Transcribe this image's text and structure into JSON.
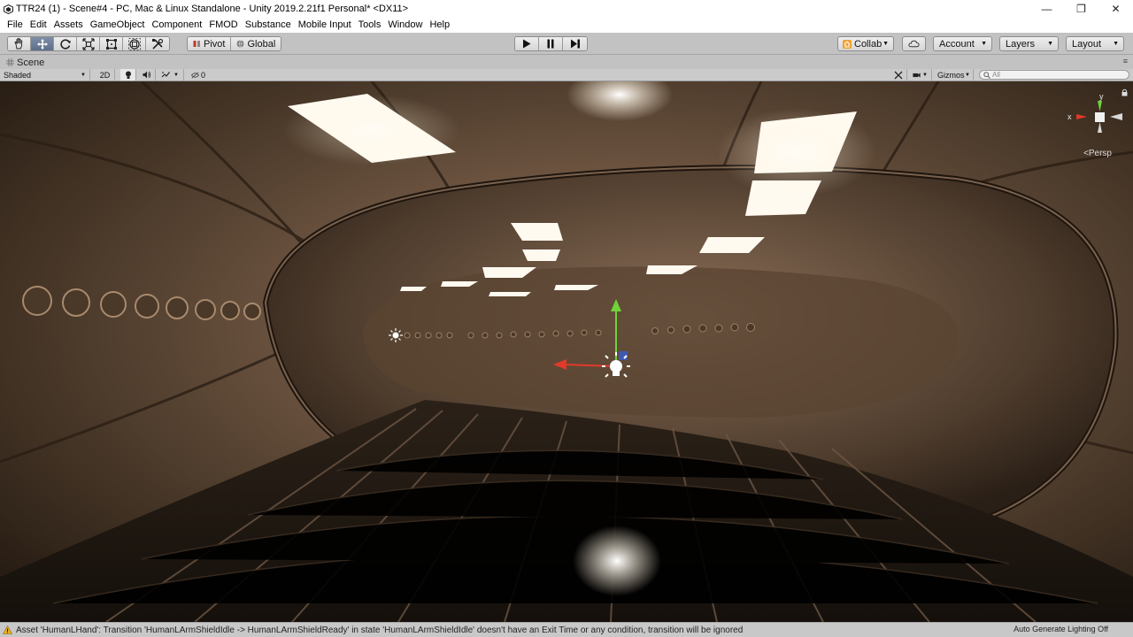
{
  "window": {
    "title": "TTR24 (1) - Scene#4 - PC, Mac & Linux Standalone - Unity 2019.2.21f1 Personal* <DX11>",
    "controls": {
      "minimize": "—",
      "restore": "❐",
      "close": "✕"
    }
  },
  "menu": {
    "items": [
      "File",
      "Edit",
      "Assets",
      "GameObject",
      "Component",
      "FMOD",
      "Substance",
      "Mobile Input",
      "Tools",
      "Window",
      "Help"
    ]
  },
  "toolbar": {
    "tools": [
      {
        "name": "hand-tool",
        "icon": "hand-icon",
        "active": false
      },
      {
        "name": "move-tool",
        "icon": "move-icon",
        "active": true
      },
      {
        "name": "rotate-tool",
        "icon": "rotate-icon",
        "active": false
      },
      {
        "name": "scale-tool",
        "icon": "scale-icon",
        "active": false
      },
      {
        "name": "rect-tool",
        "icon": "rect-icon",
        "active": false
      },
      {
        "name": "transform-tool",
        "icon": "transform-icon",
        "active": false
      },
      {
        "name": "custom-tool",
        "icon": "custom-tool-icon",
        "active": false
      }
    ],
    "pivot_label": "Pivot",
    "global_label": "Global",
    "play_icon": "▶",
    "pause_icon": "❚❚",
    "step_icon": "▶|",
    "collab_label": "Collab",
    "account_label": "Account",
    "layers_label": "Layers",
    "layout_label": "Layout"
  },
  "scene_tab": {
    "label": "Scene",
    "menu_icon": "≡"
  },
  "scene_toolbar": {
    "shading_mode": "Shaded",
    "mode_2d": "2D",
    "hidden_count": "0",
    "gizmos_label": "Gizmos",
    "search_placeholder": "All"
  },
  "viewport": {
    "projection_label": "Persp",
    "axis_x": "x",
    "axis_y": "y"
  },
  "statusbar": {
    "message": "Asset 'HumanLHand': Transition 'HumanLArmShieldIdle -> HumanLArmShieldReady' in state 'HumanLArmShieldIdle' doesn't have an Exit Time or any condition, transition will be ignored",
    "lighting": "Auto Generate Lighting Off"
  },
  "colors": {
    "editor_bg": "#c2c2c2",
    "active_tool": "#5c6e8a",
    "axis_x": "#e03a2a",
    "axis_y": "#6fd23a",
    "tunnel_metal": "#6b5440"
  }
}
